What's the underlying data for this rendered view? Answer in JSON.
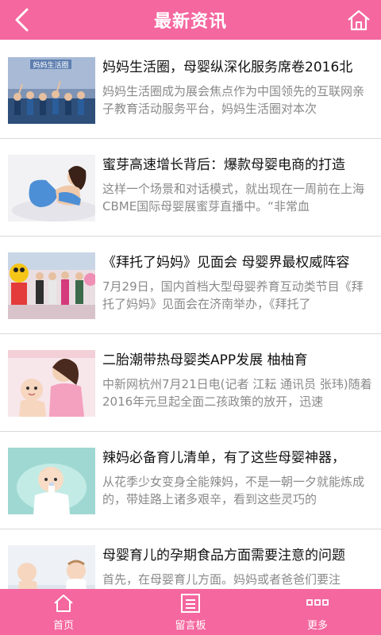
{
  "header": {
    "title": "最新资讯",
    "back_icon": "chevron-left-icon",
    "home_icon": "home-icon"
  },
  "news": [
    {
      "headline": "妈妈生活圈，母婴纵深化服务席卷2016北",
      "summary": "妈妈生活圈成为展会焦点作为中国领先的互联网亲子教育活动服务平台，妈妈生活圈对本次",
      "thumb_text": "妈妈生活圈"
    },
    {
      "headline": "蜜芽高速增长背后：爆款母婴电商的打造",
      "summary": "这样一个场景和对话模式，就出现在一周前在上海CBME国际母婴展蜜芽直播中。“非常血"
    },
    {
      "headline": "《拜托了妈妈》见面会 母婴界最权威阵容",
      "summary": "7月29日，国内首档大型母婴养育互动类节目《拜托了妈妈》见面会在济南举办，《拜托了"
    },
    {
      "headline": "二胎潮带热母婴类APP发展 柚柚育",
      "summary": "中新网杭州7月21日电(记者 江耘 通讯员 张玮)随着2016年元旦起全面二孩政策的放开，迅速"
    },
    {
      "headline": "辣妈必备育儿清单，有了这些母婴神器，",
      "summary": "从花季少女变身全能辣妈，不是一朝一夕就能炼成的，带娃路上诸多艰辛，看到这些灵巧的"
    },
    {
      "headline": "母婴育儿的孕期食品方面需要注意的问题",
      "summary": "首先，在母婴育儿方面。妈妈或者爸爸们要注"
    }
  ],
  "footer": {
    "tabs": [
      {
        "label": "首页",
        "icon": "home-icon"
      },
      {
        "label": "留言板",
        "icon": "message-board-icon"
      },
      {
        "label": "更多",
        "icon": "more-icon"
      }
    ]
  },
  "colors": {
    "primary": "#f4679f"
  }
}
